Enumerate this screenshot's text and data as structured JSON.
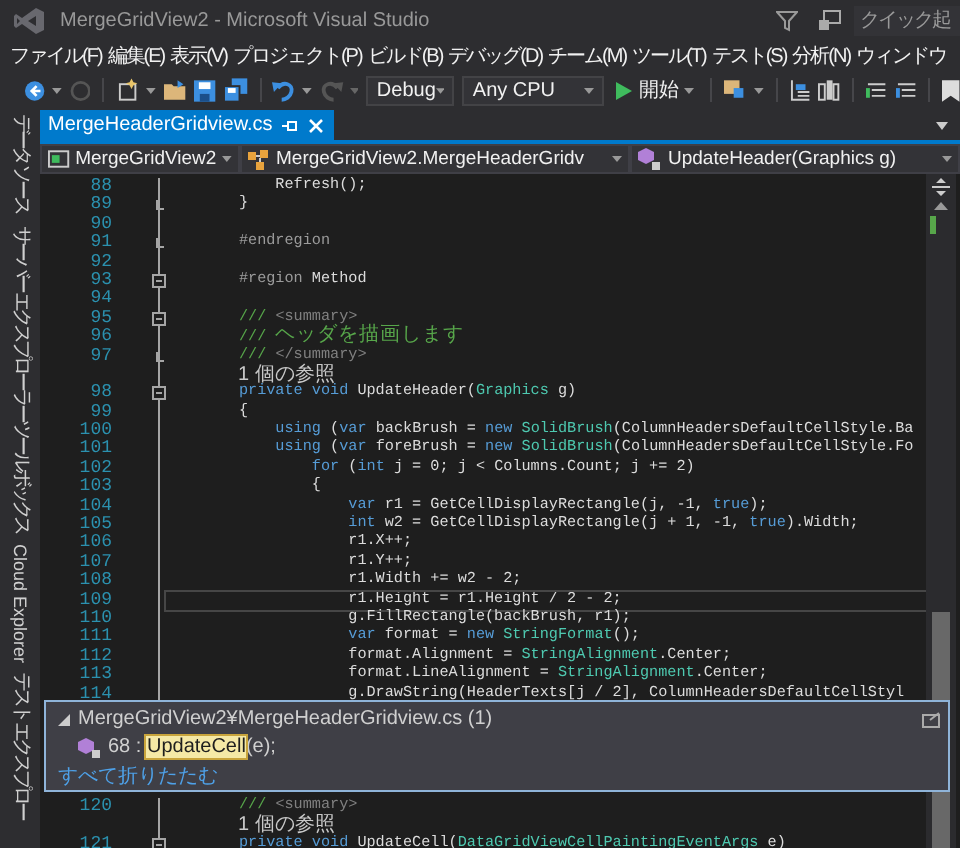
{
  "window": {
    "title": "MergeGridView2 - Microsoft Visual Studio",
    "quick_launch": {
      "placeholder": "クイック起"
    }
  },
  "menu": [
    "ファイル(F)",
    "編集(E)",
    "表示(V)",
    "プロジェクト(P)",
    "ビルド(B)",
    "デバッグ(D)",
    "チーム(M)",
    "ツール(T)",
    "テスト(S)",
    "分析(N)",
    "ウィンドウ"
  ],
  "toolbar": {
    "configuration": "Debug",
    "platform": "Any CPU",
    "start": "開始"
  },
  "side_tabs": [
    "データ ソース",
    "サーバー エクスプローラー",
    "ツールボックス",
    "Cloud Explorer",
    "テスト エクスプロー"
  ],
  "document_tabs": [
    {
      "label": "MergeHeaderGridview.cs",
      "selected": true
    }
  ],
  "navigation": {
    "project": "MergeGridView2",
    "type": "MergeGridView2.MergeHeaderGridv",
    "member": "UpdateHeader(Graphics g)"
  },
  "editor": {
    "lines": [
      {
        "kind": "code",
        "n": "88",
        "current": false,
        "collapsible": false,
        "block_end": false,
        "tokens": [
          {
            "kind": "plain",
            "text": "            Refresh();"
          }
        ]
      },
      {
        "kind": "code",
        "n": "89",
        "current": false,
        "collapsible": false,
        "block_end": true,
        "tokens": [
          {
            "kind": "plain",
            "text": "        }"
          }
        ]
      },
      {
        "kind": "code",
        "n": "90",
        "current": false,
        "collapsible": false,
        "block_end": false
      },
      {
        "kind": "code",
        "n": "91",
        "current": false,
        "collapsible": false,
        "block_end": true,
        "tokens": [
          {
            "kind": "directive",
            "text": "        #endregion"
          }
        ]
      },
      {
        "kind": "code",
        "n": "92",
        "current": false,
        "collapsible": false,
        "block_end": false
      },
      {
        "kind": "code",
        "n": "93",
        "current": false,
        "collapsible": true,
        "block_end": false,
        "tokens": [
          {
            "kind": "directive",
            "text": "        #region"
          },
          {
            "kind": "plain",
            "text": " Method"
          }
        ]
      },
      {
        "kind": "code",
        "n": "94",
        "current": false,
        "collapsible": false,
        "block_end": false
      },
      {
        "kind": "code",
        "n": "95",
        "current": false,
        "collapsible": true,
        "block_end": false,
        "tokens": [
          {
            "kind": "comment",
            "text": "        ///"
          },
          {
            "kind": "doctag",
            "text": " <summary>"
          }
        ]
      },
      {
        "kind": "code",
        "n": "96",
        "current": false,
        "collapsible": false,
        "block_end": false,
        "tokens": [
          {
            "kind": "comment",
            "text": "        ///"
          },
          {
            "kind": "comment_cjk",
            "text": "ヘッダを描画します"
          }
        ]
      },
      {
        "kind": "code",
        "n": "97",
        "current": false,
        "collapsible": false,
        "block_end": true,
        "tokens": [
          {
            "kind": "comment",
            "text": "        ///"
          },
          {
            "kind": "doctag",
            "text": " </summary>"
          }
        ]
      },
      {
        "kind": "codelens",
        "text": "1 個の参照"
      },
      {
        "kind": "code",
        "n": "98",
        "current": false,
        "collapsible": true,
        "block_end": false,
        "tokens": [
          {
            "kind": "keyword",
            "text": "        private void"
          },
          {
            "kind": "plain",
            "text": " UpdateHeader("
          },
          {
            "kind": "type",
            "text": "Graphics"
          },
          {
            "kind": "plain",
            "text": " g)"
          }
        ]
      },
      {
        "kind": "code",
        "n": "99",
        "current": false,
        "collapsible": false,
        "block_end": false,
        "tokens": [
          {
            "kind": "plain",
            "text": "        {"
          }
        ]
      },
      {
        "kind": "code",
        "n": "100",
        "current": false,
        "collapsible": false,
        "block_end": false,
        "tokens": [
          {
            "kind": "keyword",
            "text": "            using"
          },
          {
            "kind": "plain",
            "text": " ("
          },
          {
            "kind": "keyword",
            "text": "var"
          },
          {
            "kind": "plain",
            "text": " backBrush = "
          },
          {
            "kind": "keyword",
            "text": "new"
          },
          {
            "kind": "type",
            "text": " SolidBrush"
          },
          {
            "kind": "plain",
            "text": "(ColumnHeadersDefaultCellStyle.Ba"
          }
        ]
      },
      {
        "kind": "code",
        "n": "101",
        "current": false,
        "collapsible": false,
        "block_end": false,
        "tokens": [
          {
            "kind": "keyword",
            "text": "            using"
          },
          {
            "kind": "plain",
            "text": " ("
          },
          {
            "kind": "keyword",
            "text": "var"
          },
          {
            "kind": "plain",
            "text": " foreBrush = "
          },
          {
            "kind": "keyword",
            "text": "new"
          },
          {
            "kind": "type",
            "text": " SolidBrush"
          },
          {
            "kind": "plain",
            "text": "(ColumnHeadersDefaultCellStyle.Fo"
          }
        ]
      },
      {
        "kind": "code",
        "n": "102",
        "current": false,
        "collapsible": false,
        "block_end": false,
        "tokens": [
          {
            "kind": "keyword",
            "text": "                for"
          },
          {
            "kind": "plain",
            "text": " ("
          },
          {
            "kind": "keyword",
            "text": "int"
          },
          {
            "kind": "plain",
            "text": " j = 0; j < Columns.Count; j += 2)"
          }
        ]
      },
      {
        "kind": "code",
        "n": "103",
        "current": false,
        "collapsible": false,
        "block_end": false,
        "tokens": [
          {
            "kind": "plain",
            "text": "                {"
          }
        ]
      },
      {
        "kind": "code",
        "n": "104",
        "current": false,
        "collapsible": false,
        "block_end": false,
        "tokens": [
          {
            "kind": "keyword",
            "text": "                    var"
          },
          {
            "kind": "plain",
            "text": " r1 = GetCellDisplayRectangle(j, -1, "
          },
          {
            "kind": "keyword",
            "text": "true"
          },
          {
            "kind": "plain",
            "text": ");"
          }
        ]
      },
      {
        "kind": "code",
        "n": "105",
        "current": false,
        "collapsible": false,
        "block_end": false,
        "tokens": [
          {
            "kind": "keyword",
            "text": "                    int"
          },
          {
            "kind": "plain",
            "text": " w2 = GetCellDisplayRectangle(j + 1, -1, "
          },
          {
            "kind": "keyword",
            "text": "true"
          },
          {
            "kind": "plain",
            "text": ").Width;"
          }
        ]
      },
      {
        "kind": "code",
        "n": "106",
        "current": false,
        "collapsible": false,
        "block_end": false,
        "tokens": [
          {
            "kind": "plain",
            "text": "                    r1.X++;"
          }
        ]
      },
      {
        "kind": "code",
        "n": "107",
        "current": false,
        "collapsible": false,
        "block_end": false,
        "tokens": [
          {
            "kind": "plain",
            "text": "                    r1.Y++;"
          }
        ]
      },
      {
        "kind": "code",
        "n": "108",
        "current": false,
        "collapsible": false,
        "block_end": false,
        "tokens": [
          {
            "kind": "plain",
            "text": "                    r1.Width += w2 - 2;"
          }
        ]
      },
      {
        "kind": "code",
        "n": "109",
        "current": true,
        "collapsible": false,
        "block_end": false,
        "tokens": [
          {
            "kind": "plain",
            "text": "                    r1.Height = r1.Height / 2 - 2;"
          }
        ]
      },
      {
        "kind": "code",
        "n": "110",
        "current": false,
        "collapsible": false,
        "block_end": false,
        "tokens": [
          {
            "kind": "plain",
            "text": "                    g.FillRectangle(backBrush, r1);"
          }
        ]
      },
      {
        "kind": "code",
        "n": "111",
        "current": false,
        "collapsible": false,
        "block_end": false,
        "tokens": [
          {
            "kind": "keyword",
            "text": "                    var"
          },
          {
            "kind": "plain",
            "text": " format = "
          },
          {
            "kind": "keyword",
            "text": "new"
          },
          {
            "kind": "type",
            "text": " StringFormat"
          },
          {
            "kind": "plain",
            "text": "();"
          }
        ]
      },
      {
        "kind": "code",
        "n": "112",
        "current": false,
        "collapsible": false,
        "block_end": false,
        "tokens": [
          {
            "kind": "plain",
            "text": "                    format.Alignment = "
          },
          {
            "kind": "type",
            "text": "StringAlignment"
          },
          {
            "kind": "plain",
            "text": ".Center;"
          }
        ]
      },
      {
        "kind": "code",
        "n": "113",
        "current": false,
        "collapsible": false,
        "block_end": false,
        "tokens": [
          {
            "kind": "plain",
            "text": "                    format.LineAlignment = "
          },
          {
            "kind": "type",
            "text": "StringAlignment"
          },
          {
            "kind": "plain",
            "text": ".Center;"
          }
        ]
      },
      {
        "kind": "code",
        "n": "114",
        "current": false,
        "collapsible": false,
        "block_end": false,
        "tokens": [
          {
            "kind": "plain",
            "text": "                    g.DrawString(HeaderTexts[j / 2], ColumnHeadersDefaultCellStyl"
          }
        ]
      }
    ],
    "peek": {
      "path": "MergeGridView2¥MergeHeaderGridview.cs (1)",
      "expanded": true,
      "reference": {
        "line": "68 :",
        "match": "UpdateCell",
        "rest": "(e);"
      },
      "collapse_all": "すべて折りたたむ"
    },
    "lines_after": [
      {
        "kind": "code",
        "n": "120",
        "current": false,
        "collapsible": false,
        "block_end": false,
        "tokens": [
          {
            "kind": "comment",
            "text": "        ///"
          },
          {
            "kind": "doctag",
            "text": " <summary>"
          }
        ]
      },
      {
        "kind": "codelens",
        "text": "1 個の参照"
      },
      {
        "kind": "code",
        "n": "121",
        "current": false,
        "collapsible": true,
        "block_end": false,
        "tokens": [
          {
            "kind": "keyword",
            "text": "        private void"
          },
          {
            "kind": "plain",
            "text": " UpdateCell("
          },
          {
            "kind": "type",
            "text": "DataGridViewCellPaintingEventArgs"
          },
          {
            "kind": "plain",
            "text": " e)"
          }
        ]
      }
    ]
  }
}
